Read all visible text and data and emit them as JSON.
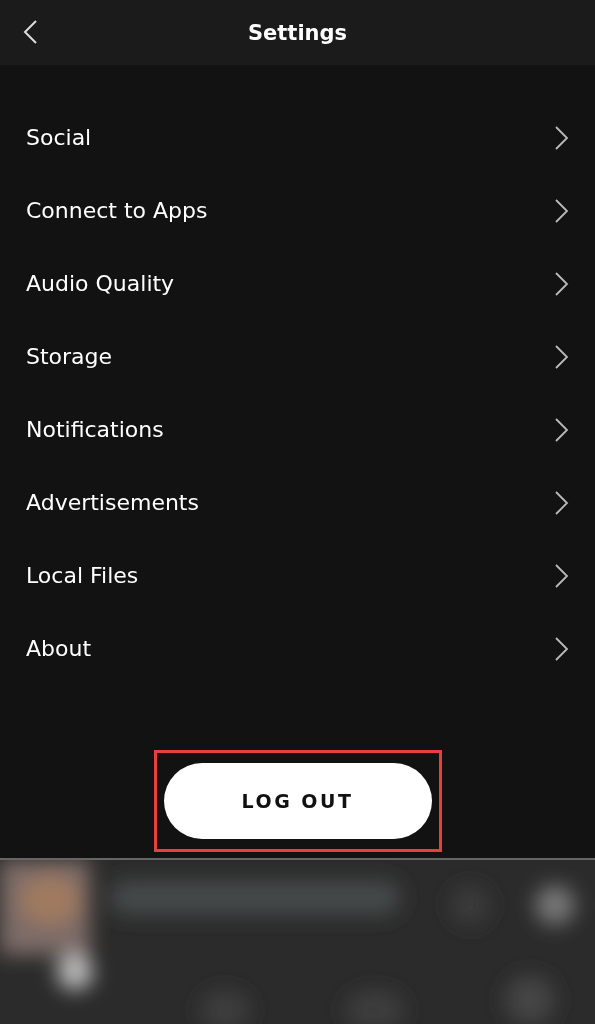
{
  "header": {
    "title": "Settings"
  },
  "settings_items": [
    {
      "label": "Social"
    },
    {
      "label": "Connect to Apps"
    },
    {
      "label": "Audio Quality"
    },
    {
      "label": "Storage"
    },
    {
      "label": "Notifications"
    },
    {
      "label": "Advertisements"
    },
    {
      "label": "Local Files"
    },
    {
      "label": "About"
    }
  ],
  "logout_button": {
    "label": "LOG OUT",
    "highlighted": true
  }
}
